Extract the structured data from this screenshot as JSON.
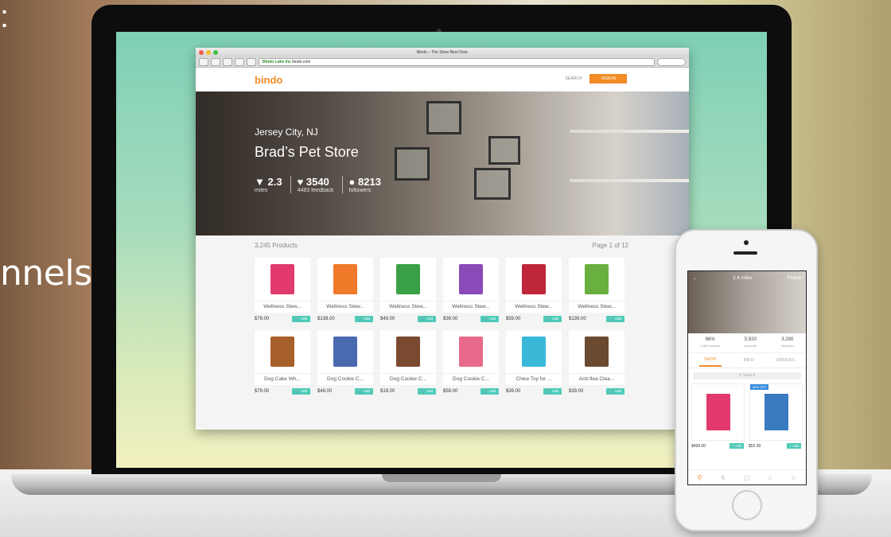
{
  "left": {
    "partial_text": "nnels.",
    "punct": ":"
  },
  "browser": {
    "title": "Bindo – The Store Next Door",
    "url_cert": "Bindo Labs Inc",
    "url": "bindo.com",
    "logo": "bindo",
    "search_label": "SEARCH",
    "signin_label": "SIGN IN"
  },
  "store": {
    "city": "Jersey City, NJ",
    "name": "Brad’s Pet Store",
    "stats": [
      {
        "icon": "location-icon",
        "value": "2.3",
        "label": "miles"
      },
      {
        "icon": "heart-icon",
        "value": "3540",
        "label": "4483 feedback"
      },
      {
        "icon": "person-icon",
        "value": "8213",
        "label": "followers"
      }
    ]
  },
  "products_header": {
    "count": "3,245 Products",
    "page": "Page 1 of 12"
  },
  "products": [
    {
      "name": "Wellness Stew...",
      "price": "$79.00",
      "color": "#e23a6c",
      "add": "Add"
    },
    {
      "name": "Wellness Stew...",
      "price": "$139.00",
      "color": "#f07a2a",
      "add": "Add"
    },
    {
      "name": "Wellness Stew...",
      "price": "$49.00",
      "color": "#3aa046",
      "add": "Add"
    },
    {
      "name": "Wellness Stew...",
      "price": "$39.00",
      "color": "#8a4ab8",
      "add": "Add"
    },
    {
      "name": "Wellness Stew...",
      "price": "$59.00",
      "color": "#c0263a",
      "add": "Add"
    },
    {
      "name": "Wellness Stew...",
      "price": "$139.00",
      "color": "#6ab040",
      "add": "Add"
    },
    {
      "name": "Dog Cake Wh...",
      "price": "$79.00",
      "color": "#a8602a",
      "add": "Add"
    },
    {
      "name": "Dog Cookie C...",
      "price": "$49.00",
      "color": "#4a6ab0",
      "add": "Add"
    },
    {
      "name": "Dog Cookie C...",
      "price": "$19.00",
      "color": "#7a4a30",
      "add": "Add"
    },
    {
      "name": "Dog Cookie C...",
      "price": "$59.00",
      "color": "#e86a8a",
      "add": "Add"
    },
    {
      "name": "Chew Toy for ...",
      "price": "$39.00",
      "color": "#3ab8d8",
      "add": "Add"
    },
    {
      "name": "Anti-flea Clea...",
      "price": "$39.00",
      "color": "#6a4a30",
      "add": "Add"
    }
  ],
  "phone": {
    "distance": "2.4 miles",
    "follow": "Follow",
    "stats": [
      {
        "value": "86%",
        "label": "5,860 reviews"
      },
      {
        "value": "5,920",
        "label": "products"
      },
      {
        "value": "3,290",
        "label": "followers"
      }
    ],
    "tabs": [
      "SHOP",
      "INFO",
      "ORDERS"
    ],
    "search_placeholder": "Search",
    "badge": "50% OFF",
    "products": [
      {
        "price": "$499.00",
        "add": "+ Add",
        "color": "#e23a6c"
      },
      {
        "price": "$52.00",
        "add": "+ Add",
        "color": "#3a7ac0"
      }
    ]
  }
}
